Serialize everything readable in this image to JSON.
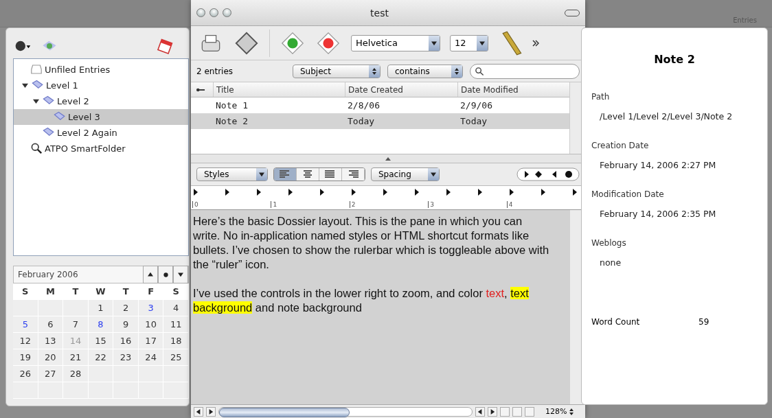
{
  "background": {
    "label": "Entries"
  },
  "window": {
    "title": "test"
  },
  "toolbar": {
    "font": "Helvetica",
    "size": "12"
  },
  "sidebar": {
    "items": [
      {
        "label": "Unfiled Entries",
        "kind": "inbox",
        "selected": false
      },
      {
        "label": "Level 1",
        "kind": "folder",
        "selected": false,
        "expanded": true,
        "children": [
          {
            "label": "Level 2",
            "kind": "folder",
            "selected": false,
            "expanded": true,
            "children": [
              {
                "label": "Level 3",
                "kind": "folder",
                "selected": true
              }
            ]
          },
          {
            "label": "Level 2 Again",
            "kind": "folder",
            "selected": false
          }
        ]
      },
      {
        "label": "ATPO SmartFolder",
        "kind": "smart",
        "selected": false
      }
    ]
  },
  "calendar": {
    "month": "February 2006",
    "weekdays": [
      "S",
      "M",
      "T",
      "W",
      "T",
      "F",
      "S"
    ],
    "weeks": [
      [
        {
          "day": "1",
          "has_entry": false,
          "today": false
        },
        {
          "day": "2",
          "has_entry": false,
          "today": false
        },
        {
          "day": "3",
          "has_entry": true,
          "today": false
        },
        {
          "day": "4",
          "has_entry": false,
          "today": false
        }
      ],
      [
        {
          "day": "5",
          "has_entry": true,
          "today": false
        },
        {
          "day": "6",
          "has_entry": false,
          "today": false
        },
        {
          "day": "7",
          "has_entry": false,
          "today": false
        },
        {
          "day": "8",
          "has_entry": true,
          "today": false
        },
        {
          "day": "9",
          "has_entry": false,
          "today": false
        },
        {
          "day": "10",
          "has_entry": false,
          "today": false
        },
        {
          "day": "11",
          "has_entry": false,
          "today": false
        }
      ],
      [
        {
          "day": "12",
          "has_entry": false,
          "today": false
        },
        {
          "day": "13",
          "has_entry": false,
          "today": false
        },
        {
          "day": "14",
          "has_entry": false,
          "today": true
        },
        {
          "day": "15",
          "has_entry": false,
          "today": false
        },
        {
          "day": "16",
          "has_entry": false,
          "today": false
        },
        {
          "day": "17",
          "has_entry": false,
          "today": false
        },
        {
          "day": "18",
          "has_entry": false,
          "today": false
        }
      ],
      [
        {
          "day": "19",
          "has_entry": false,
          "today": false
        },
        {
          "day": "20",
          "has_entry": false,
          "today": false
        },
        {
          "day": "21",
          "has_entry": false,
          "today": false
        },
        {
          "day": "22",
          "has_entry": false,
          "today": false
        },
        {
          "day": "23",
          "has_entry": false,
          "today": false
        },
        {
          "day": "24",
          "has_entry": false,
          "today": false
        },
        {
          "day": "25",
          "has_entry": false,
          "today": false
        }
      ],
      [
        {
          "day": "26",
          "has_entry": false,
          "today": false
        },
        {
          "day": "27",
          "has_entry": false,
          "today": false
        },
        {
          "day": "28",
          "has_entry": false,
          "today": false
        }
      ]
    ]
  },
  "search": {
    "count": "2 entries",
    "field": "Subject",
    "operator": "contains"
  },
  "table": {
    "columns": [
      "Title",
      "Date Created",
      "Date Modified"
    ],
    "rows": [
      {
        "cells": [
          "Note 1",
          "2/8/06",
          "2/9/06"
        ],
        "selected": false
      },
      {
        "cells": [
          "Note 2",
          "Today",
          "Today"
        ],
        "selected": true
      }
    ]
  },
  "format_bar": {
    "styles": "Styles",
    "spacing": "Spacing",
    "alignments": [
      {
        "kind": "left",
        "selected": true
      },
      {
        "kind": "center",
        "selected": false
      },
      {
        "kind": "justify",
        "selected": false
      },
      {
        "kind": "right",
        "selected": false
      }
    ]
  },
  "ruler": {
    "labels": [
      "0",
      "1",
      "2",
      "3",
      "4"
    ]
  },
  "editor": {
    "paragraphs": [
      [
        {
          "text": "Here’s the basic Dossier layout. This is the pane in which you can write. No in-application named styles or HTML shortcut formats like bullets. I’ve chosen to show the rulerbar which is toggleable above with the “ruler” icon.",
          "kind": "plain"
        }
      ],
      [
        {
          "text": "I’ve used the controls in the lower right to zoom, and color ",
          "kind": "plain"
        },
        {
          "text": "text",
          "kind": "red"
        },
        {
          "text": ", ",
          "kind": "plain"
        },
        {
          "text": "text background",
          "kind": "highlight"
        },
        {
          "text": " and note background",
          "kind": "plain"
        }
      ]
    ]
  },
  "status_bar": {
    "zoom": "128%"
  },
  "info": {
    "title": "Note 2",
    "fields": [
      {
        "label": "Path",
        "value": "/Level 1/Level 2/Level 3/Note 2",
        "kind": "stacked"
      },
      {
        "label": "Creation Date",
        "value": "February 14, 2006 2:27 PM",
        "kind": "stacked"
      },
      {
        "label": "Modification Date",
        "value": "February 14, 2006 2:35 PM",
        "kind": "stacked"
      },
      {
        "label": "Weblogs",
        "value": "none",
        "kind": "stacked"
      },
      {
        "label": "Word Count",
        "value": "59",
        "kind": "inline"
      }
    ]
  }
}
